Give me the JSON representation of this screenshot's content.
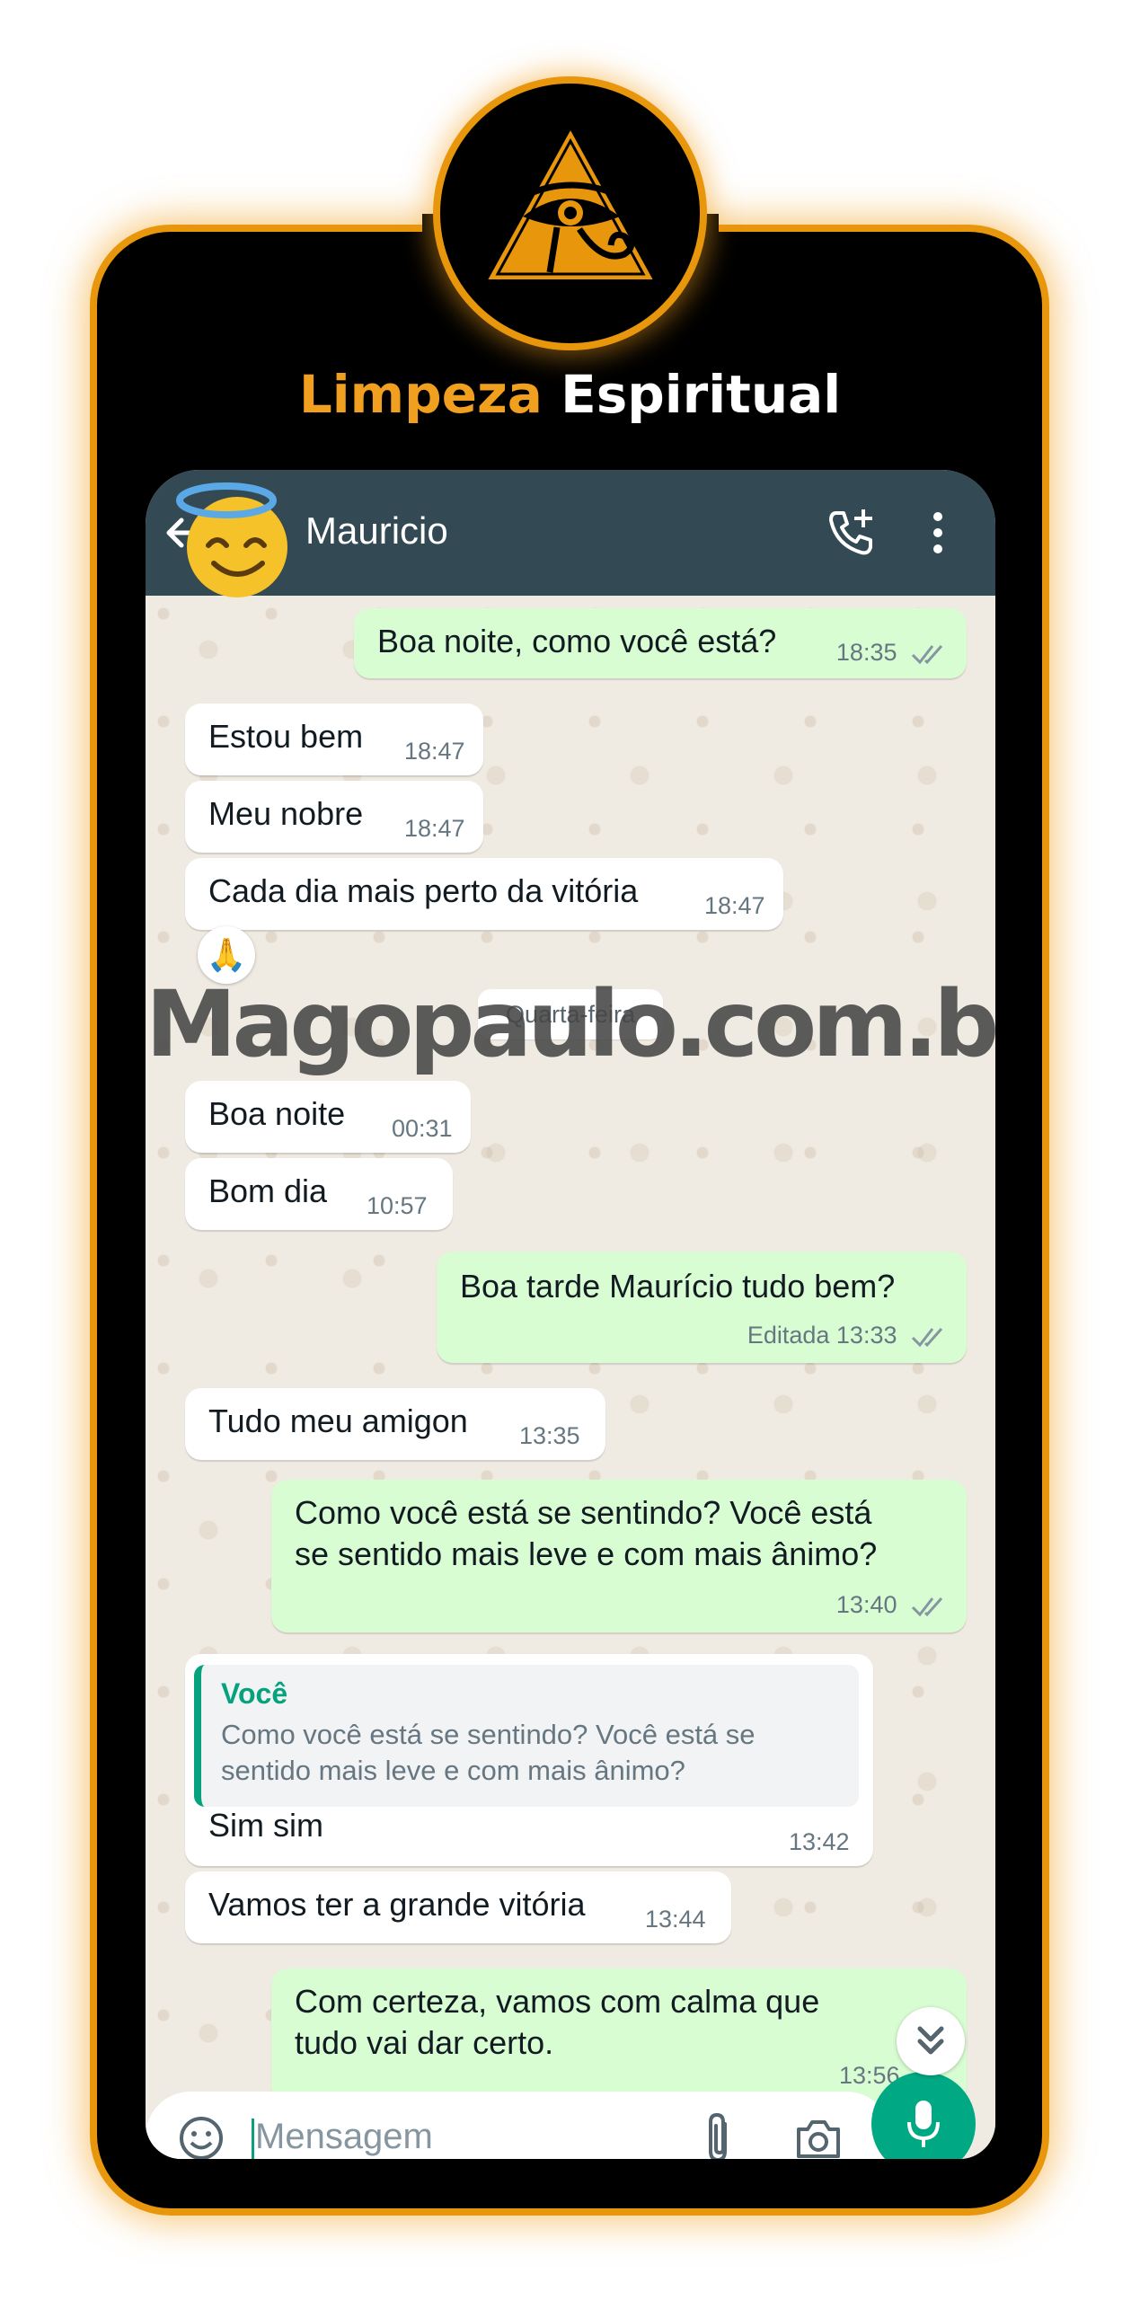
{
  "brand": {
    "title_word1": "Limpeza",
    "title_word2": "Espiritual"
  },
  "colors": {
    "accent": "#f0a01e",
    "header": "#334a55",
    "bubble_out": "#d9fdd3",
    "bubble_in": "#ffffff",
    "whatsapp_green": "#00a884"
  },
  "header": {
    "contact_name": "Mauricio",
    "avatar_emoji": "😇"
  },
  "messages": [
    {
      "dir": "out",
      "text": "Boa noite, como você está?",
      "time": "18:35",
      "read": true
    },
    {
      "dir": "in",
      "text": "Estou bem",
      "time": "18:47"
    },
    {
      "dir": "in",
      "text": "Meu nobre",
      "time": "18:47"
    },
    {
      "dir": "in",
      "text": "Cada dia mais perto da vitória",
      "time": "18:47",
      "reaction": "🙏"
    },
    {
      "dir": "in",
      "text": "Boa noite",
      "time": "00:31"
    },
    {
      "dir": "in",
      "text": "Bom dia",
      "time": "10:57"
    },
    {
      "dir": "out",
      "text": "Boa tarde Maurício tudo bem?",
      "edited_label": "Editada",
      "time": "13:33",
      "read": true
    },
    {
      "dir": "in",
      "text": "Tudo meu amigon",
      "time": "13:35"
    },
    {
      "dir": "out",
      "text": "Como você está se sentindo? Você está\nse sentido mais leve e com mais ânimo?",
      "time": "13:40",
      "read": true
    },
    {
      "dir": "in",
      "quote_author": "Você",
      "quote_text": "Como você está se sentindo? Você está se\nsentido mais leve e com mais ânimo?",
      "text": "Sim sim",
      "time": "13:42"
    },
    {
      "dir": "in",
      "text": "Vamos ter a grande vitória",
      "time": "13:44"
    },
    {
      "dir": "out",
      "text": "Com certeza, vamos com calma que\ntudo vai dar certo.",
      "time": "13:56"
    }
  ],
  "date_divider": "Quarta-feira",
  "watermark": "Magopaulo.com.br",
  "input": {
    "placeholder": "Mensagem"
  }
}
